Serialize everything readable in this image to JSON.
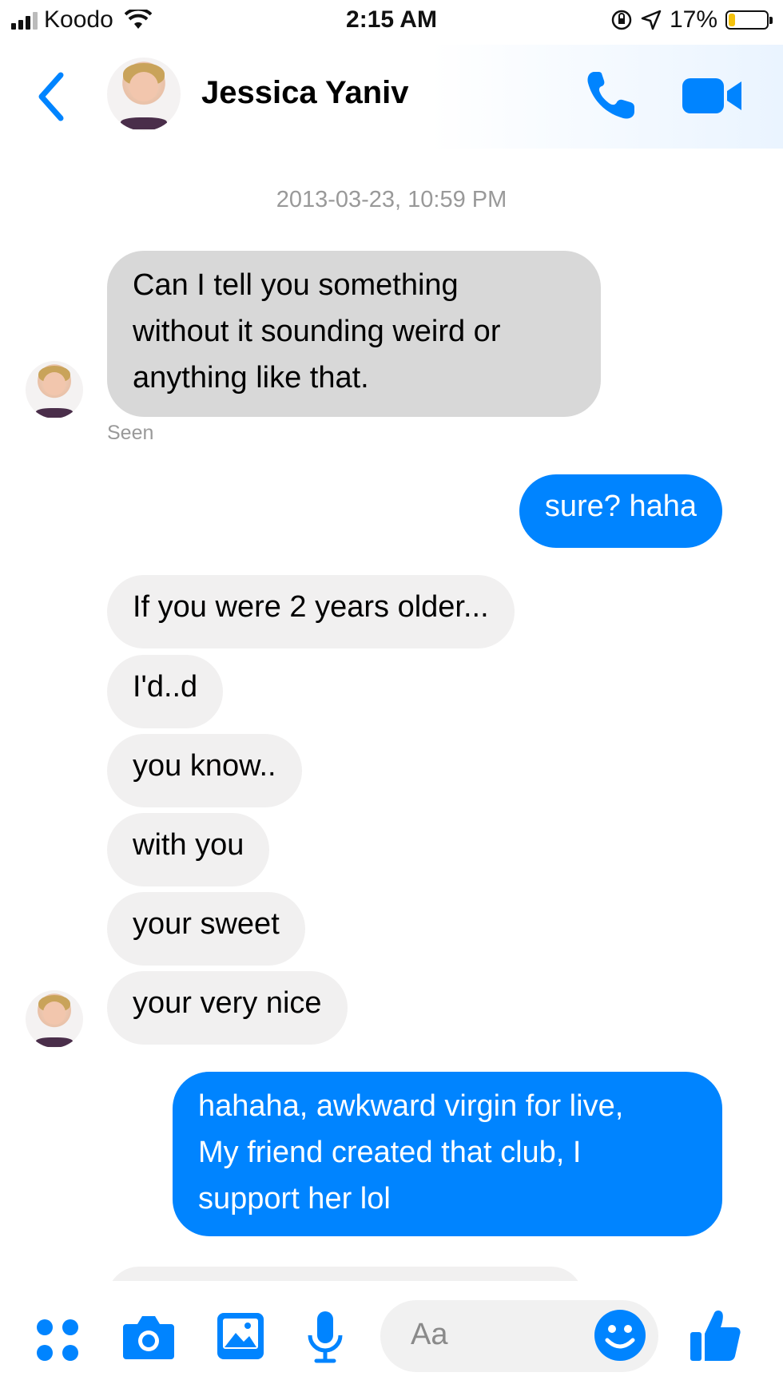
{
  "status_bar": {
    "carrier": "Koodo",
    "time": "2:15 AM",
    "battery_percent": "17%",
    "battery_level": 0.17
  },
  "header": {
    "contact_name": "Jessica Yaniv",
    "back_icon": "chevron-left-icon",
    "call_icon": "phone-icon",
    "video_icon": "video-camera-icon"
  },
  "conversation": {
    "timestamp": "2013-03-23, 10:59 PM",
    "messages": [
      {
        "direction": "incoming",
        "lines": [
          "Can I tell you something",
          "without it sounding weird or",
          "anything like that."
        ]
      },
      {
        "direction": "outgoing",
        "lines": [
          "sure? haha"
        ]
      },
      {
        "direction": "incoming",
        "lines": [
          "If you were 2 years older..."
        ]
      },
      {
        "direction": "incoming",
        "lines": [
          "I'd..d"
        ]
      },
      {
        "direction": "incoming",
        "lines": [
          "you know.."
        ]
      },
      {
        "direction": "incoming",
        "lines": [
          "with you"
        ]
      },
      {
        "direction": "incoming",
        "lines": [
          "your sweet"
        ]
      },
      {
        "direction": "incoming",
        "lines": [
          "your very nice"
        ]
      },
      {
        "direction": "outgoing",
        "lines": [
          "hahaha, awkward virgin for live,",
          "My friend created that club, I",
          "support her lol"
        ]
      }
    ],
    "seen_label": "Seen"
  },
  "composer": {
    "placeholder": "Aa",
    "icons": [
      "apps-grid-icon",
      "camera-icon",
      "gallery-icon",
      "microphone-icon",
      "emoji-icon",
      "thumbs-up-icon"
    ]
  },
  "colors": {
    "accent": "#0084ff",
    "incoming_bubble": "#f1f0f0",
    "outgoing_text": "#ffffff"
  }
}
